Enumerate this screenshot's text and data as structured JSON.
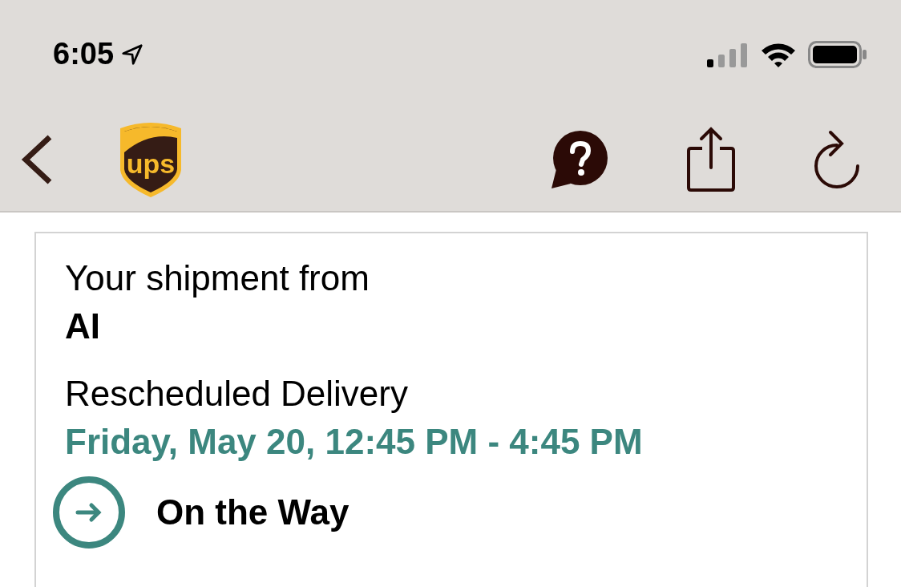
{
  "status_bar": {
    "time": "6:05",
    "location_on": true
  },
  "nav": {
    "logo_text": "ups"
  },
  "shipment": {
    "from_label": "Your shipment from",
    "sender": "AI",
    "delivery_label": "Rescheduled Delivery",
    "delivery_window": "Friday, May 20, 12:45 PM - 4:45 PM",
    "status": "On the Way"
  }
}
